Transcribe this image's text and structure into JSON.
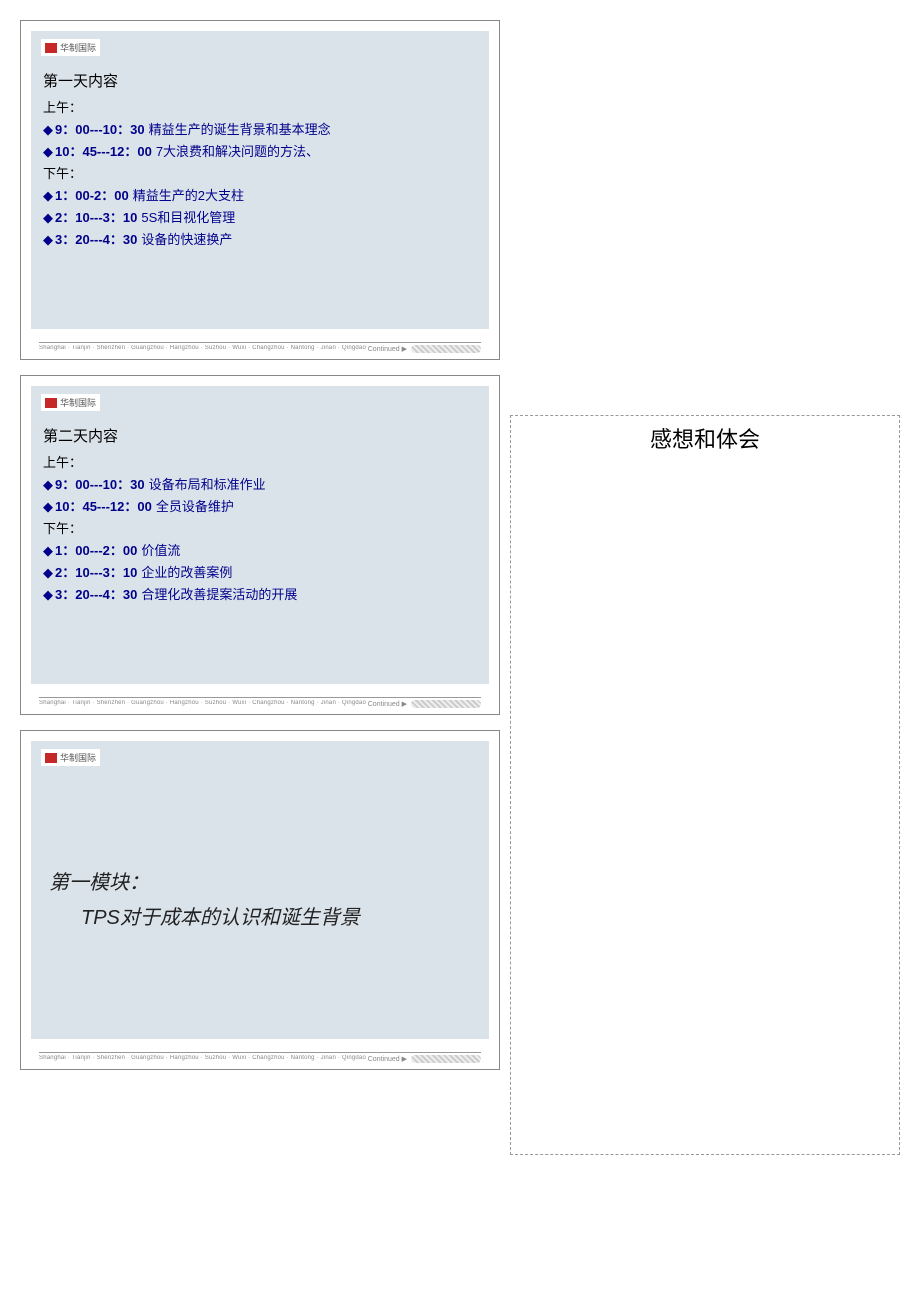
{
  "logo_text": "华制国际",
  "cities": "Shanghai · Tianjin · Shenzhen · Guangzhou · Hangzhou · Suzhou · Wuxi · Changzhou · Nantong · Jinan · Qingdao",
  "continued": "Continued ▶",
  "slide1": {
    "title": "第一天内容",
    "am": "上午：",
    "item1_time": "9：00---10：30",
    "item1_desc": "精益生产的诞生背景和基本理念",
    "item2_time": "10：45---12：00",
    "item2_desc": "7大浪费和解决问题的方法、",
    "pm": "下午：",
    "item3_time": "1：00-2：00",
    "item3_desc": "精益生产的2大支柱",
    "item4_time": "2：10---3：10",
    "item4_desc": "5S和目视化管理",
    "item5_time": "3：20---4：30",
    "item5_desc": "设备的快速换产"
  },
  "slide2": {
    "title": "第二天内容",
    "am": "上午：",
    "item1_time": "9：00---10：30",
    "item1_desc": "设备布局和标准作业",
    "item2_time": "10：45---12：00",
    "item2_desc": "全员设备维护",
    "pm": "下午：",
    "item3_time": "1：00---2：00",
    "item3_desc": "价值流",
    "item4_time": "2：10---3：10",
    "item4_desc": "企业的改善案例",
    "item5_time": "3：20---4：30",
    "item5_desc": "合理化改善提案活动的开展"
  },
  "slide3": {
    "module": "第一模块：",
    "module_title": "TPS对于成本的认识和诞生背景"
  },
  "notes_title": "感想和体会"
}
